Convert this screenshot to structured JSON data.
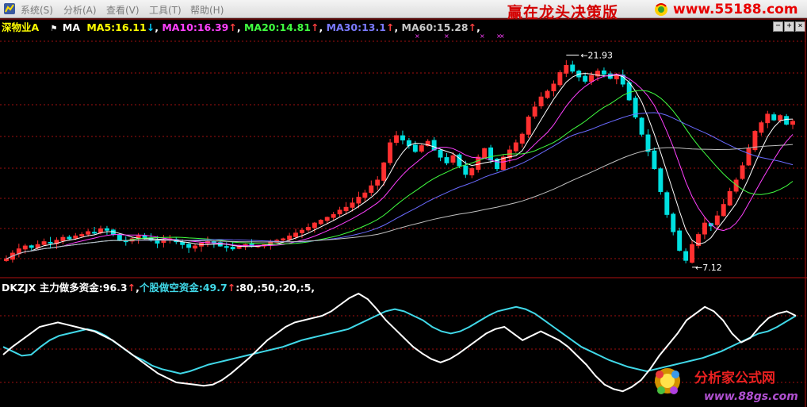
{
  "menu": {
    "items": [
      "系统(S)",
      "分析(A)",
      "查看(V)",
      "工具(T)",
      "帮助(H)"
    ]
  },
  "banner": {
    "slogan": "赢在龙头决策版",
    "site": "www.55188.com"
  },
  "window_controls": [
    "−",
    "+",
    "×"
  ],
  "ma_legend": {
    "stock_name": "深物业A",
    "ma_label": "MA",
    "ma5": "MA5:16.11",
    "ma5_arrow": "↓",
    "ma10": "MA10:16.39",
    "ma10_arrow": "↑",
    "ma20": "MA20:14.81",
    "ma20_arrow": "↑",
    "ma30": "MA30:13.1",
    "ma30_arrow": "↑",
    "ma60": "MA60:15.28",
    "ma60_arrow": "↑",
    "sep": ","
  },
  "price_markers": {
    "high": "21.93",
    "low": "7.12"
  },
  "osc_legend": {
    "name": "DKZJX",
    "bull_fund": "主力做多资金:96.3",
    "bull_arrow": "↑",
    "bear_fund": "个股做空资金:49.7",
    "bear_arrow": "↑",
    "levels": ":80,:50,:20,:5,"
  },
  "watermark": {
    "title": "分析家公式网",
    "url": "www.88gs.com"
  },
  "colors": {
    "up": "#ff3030",
    "down": "#00e0e0",
    "ma5": "#ffffff",
    "ma10": "#ff40ff",
    "ma20": "#40ff40",
    "ma30": "#6a6aff",
    "ma60": "#c0c0c0",
    "bull_line": "#ffffff",
    "bear_line": "#40d8e8",
    "grid": "#a01010"
  },
  "chart_data": {
    "type": "candlestick",
    "price": {
      "ylim": [
        6.5,
        23
      ],
      "high_label": 21.93,
      "low_label": 7.12,
      "closes": [
        7.7,
        8.1,
        8.4,
        8.6,
        8.5,
        8.7,
        8.9,
        8.8,
        9.0,
        9.2,
        9.1,
        9.3,
        9.4,
        9.6,
        9.5,
        9.8,
        9.7,
        9.4,
        9.0,
        8.9,
        9.1,
        9.3,
        9.2,
        9.0,
        8.8,
        9.0,
        9.1,
        8.9,
        8.7,
        8.5,
        8.6,
        8.8,
        8.9,
        8.8,
        8.6,
        8.5,
        8.4,
        8.6,
        8.7,
        8.6,
        8.6,
        8.7,
        8.9,
        9.0,
        9.1,
        9.3,
        9.5,
        9.7,
        9.9,
        10.2,
        10.4,
        10.6,
        10.8,
        11.1,
        11.3,
        11.6,
        12.0,
        12.3,
        12.8,
        13.2,
        14.4,
        15.8,
        16.3,
        16.0,
        15.6,
        15.2,
        15.6,
        15.9,
        15.3,
        14.8,
        14.4,
        14.9,
        14.2,
        13.6,
        14.0,
        14.8,
        15.4,
        14.6,
        14.0,
        14.8,
        15.3,
        15.8,
        16.4,
        17.6,
        18.3,
        19.0,
        19.4,
        19.9,
        20.7,
        21.2,
        20.8,
        20.4,
        20.1,
        20.5,
        20.8,
        20.6,
        20.3,
        20.5,
        19.9,
        18.8,
        17.6,
        16.4,
        15.2,
        14.0,
        12.4,
        10.8,
        9.6,
        8.3,
        7.6,
        8.7,
        9.4,
        10.2,
        10.0,
        10.7,
        11.5,
        12.4,
        13.2,
        14.2,
        15.4,
        16.6,
        17.2,
        17.8,
        17.4,
        17.7,
        17.1,
        17.3
      ]
    },
    "oscillator": {
      "ylim": [
        0,
        100
      ],
      "reference_levels": [
        80,
        50,
        20,
        5
      ],
      "bull_fund": {
        "last": 96.3,
        "values": [
          45,
          52,
          58,
          64,
          70,
          72,
          74,
          72,
          70,
          68,
          66,
          62,
          58,
          52,
          46,
          40,
          34,
          28,
          24,
          20,
          19,
          18,
          17,
          18,
          22,
          28,
          35,
          42,
          50,
          58,
          64,
          70,
          74,
          76,
          78,
          80,
          84,
          90,
          96,
          100,
          95,
          86,
          76,
          68,
          60,
          52,
          46,
          41,
          38,
          41,
          46,
          52,
          58,
          64,
          68,
          70,
          64,
          58,
          62,
          66,
          62,
          58,
          52,
          44,
          36,
          26,
          18,
          14,
          12,
          16,
          22,
          32,
          44,
          54,
          64,
          76,
          82,
          88,
          84,
          76,
          64,
          56,
          60,
          70,
          78,
          82,
          84,
          80
        ]
      },
      "bear_fund": {
        "last": 49.7,
        "values": [
          52,
          48,
          44,
          45,
          52,
          58,
          62,
          64,
          66,
          68,
          66,
          62,
          56,
          50,
          44,
          40,
          35,
          32,
          30,
          28,
          30,
          33,
          36,
          38,
          40,
          42,
          44,
          46,
          48,
          50,
          52,
          55,
          58,
          60,
          62,
          64,
          66,
          68,
          72,
          76,
          80,
          84,
          86,
          84,
          80,
          76,
          70,
          66,
          64,
          66,
          70,
          75,
          80,
          84,
          86,
          88,
          86,
          82,
          76,
          70,
          64,
          58,
          52,
          48,
          44,
          40,
          37,
          34,
          32,
          30,
          32,
          34,
          36,
          38,
          40,
          42,
          45,
          48,
          52,
          56,
          60,
          64,
          66,
          70,
          75,
          80
        ]
      }
    }
  }
}
